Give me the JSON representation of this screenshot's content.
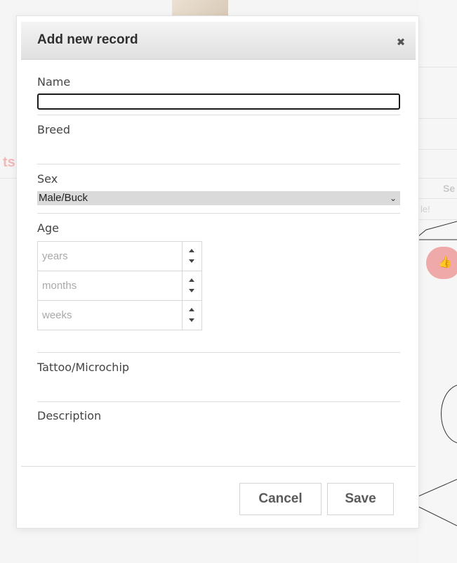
{
  "background": {
    "heading_fragment": "ts",
    "column_fragment": "Se",
    "text_fragment": "le!",
    "thumb_icon": "thumbs-up-icon"
  },
  "dialog": {
    "title": "Add new record",
    "close_icon": "close-icon",
    "fields": {
      "name": {
        "label": "Name",
        "value": ""
      },
      "breed": {
        "label": "Breed"
      },
      "sex": {
        "label": "Sex",
        "selected": "Male/Buck"
      },
      "age": {
        "label": "Age",
        "years_placeholder": "years",
        "months_placeholder": "months",
        "weeks_placeholder": "weeks"
      },
      "tattoo": {
        "label": "Tattoo/Microchip"
      },
      "description": {
        "label": "Description"
      }
    },
    "buttons": {
      "cancel": "Cancel",
      "save": "Save"
    }
  }
}
